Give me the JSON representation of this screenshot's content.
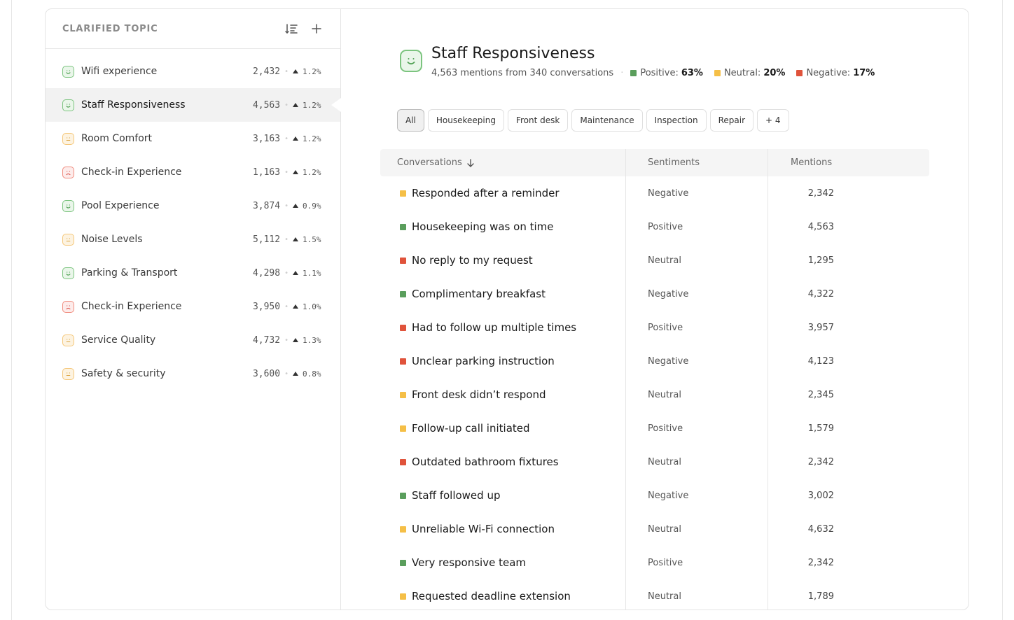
{
  "colors": {
    "positive": "#5a9e5c",
    "neutral": "#f5bf47",
    "negative": "#e0533b"
  },
  "sidebar": {
    "title": "CLARIFIED TOPIC",
    "topics": [
      {
        "name": "Wifi experience",
        "count": "2,432",
        "trend": "1.2%",
        "sentiment": "positive"
      },
      {
        "name": "Staff Responsiveness",
        "count": "4,563",
        "trend": "1.2%",
        "sentiment": "positive",
        "active": true
      },
      {
        "name": "Room Comfort",
        "count": "3,163",
        "trend": "1.2%",
        "sentiment": "neutral"
      },
      {
        "name": "Check-in Experience",
        "count": "1,163",
        "trend": "1.2%",
        "sentiment": "negative"
      },
      {
        "name": "Pool Experience",
        "count": "3,874",
        "trend": "0.9%",
        "sentiment": "positive"
      },
      {
        "name": "Noise Levels",
        "count": "5,112",
        "trend": "1.5%",
        "sentiment": "neutral"
      },
      {
        "name": "Parking & Transport",
        "count": "4,298",
        "trend": "1.1%",
        "sentiment": "positive"
      },
      {
        "name": "Check-in Experience",
        "count": "3,950",
        "trend": "1.0%",
        "sentiment": "negative"
      },
      {
        "name": "Service Quality",
        "count": "4,732",
        "trend": "1.3%",
        "sentiment": "neutral"
      },
      {
        "name": "Safety & security",
        "count": "3,600",
        "trend": "0.8%",
        "sentiment": "neutral"
      }
    ]
  },
  "header": {
    "title": "Staff Responsiveness",
    "subtitle": "4,563 mentions from 340 conversations",
    "positive_label": "Positive:",
    "positive_value": "63%",
    "neutral_label": "Neutral:",
    "neutral_value": "20%",
    "negative_label": "Negative:",
    "negative_value": "17%"
  },
  "filters": [
    "All",
    "Housekeeping",
    "Front desk",
    "Maintenance",
    "Inspection",
    "Repair",
    "+ 4"
  ],
  "table": {
    "columns": {
      "conversations": "Conversations",
      "sentiments": "Sentiments",
      "mentions": "Mentions"
    },
    "rows": [
      {
        "text": "Responded after a reminder",
        "dot": "neutral",
        "sentiment": "Negative",
        "mentions": "2,342"
      },
      {
        "text": "Housekeeping was on time",
        "dot": "positive",
        "sentiment": "Positive",
        "mentions": "4,563"
      },
      {
        "text": "No reply to my request",
        "dot": "negative",
        "sentiment": "Neutral",
        "mentions": "1,295"
      },
      {
        "text": "Complimentary breakfast",
        "dot": "positive",
        "sentiment": "Negative",
        "mentions": "4,322"
      },
      {
        "text": "Had to follow up multiple times",
        "dot": "negative",
        "sentiment": "Positive",
        "mentions": "3,957"
      },
      {
        "text": "Unclear parking instruction",
        "dot": "negative",
        "sentiment": "Negative",
        "mentions": "4,123"
      },
      {
        "text": "Front desk didn’t respond",
        "dot": "neutral",
        "sentiment": "Neutral",
        "mentions": "2,345"
      },
      {
        "text": "Follow-up call initiated",
        "dot": "neutral",
        "sentiment": "Positive",
        "mentions": "1,579"
      },
      {
        "text": "Outdated bathroom fixtures",
        "dot": "negative",
        "sentiment": "Neutral",
        "mentions": "2,342"
      },
      {
        "text": "Staff followed up",
        "dot": "positive",
        "sentiment": "Negative",
        "mentions": "3,002"
      },
      {
        "text": "Unreliable Wi-Fi connection",
        "dot": "neutral",
        "sentiment": "Neutral",
        "mentions": "4,632"
      },
      {
        "text": "Very responsive team",
        "dot": "positive",
        "sentiment": "Positive",
        "mentions": "2,342"
      },
      {
        "text": "Requested deadline extension",
        "dot": "neutral",
        "sentiment": "Neutral",
        "mentions": "1,789"
      }
    ]
  }
}
